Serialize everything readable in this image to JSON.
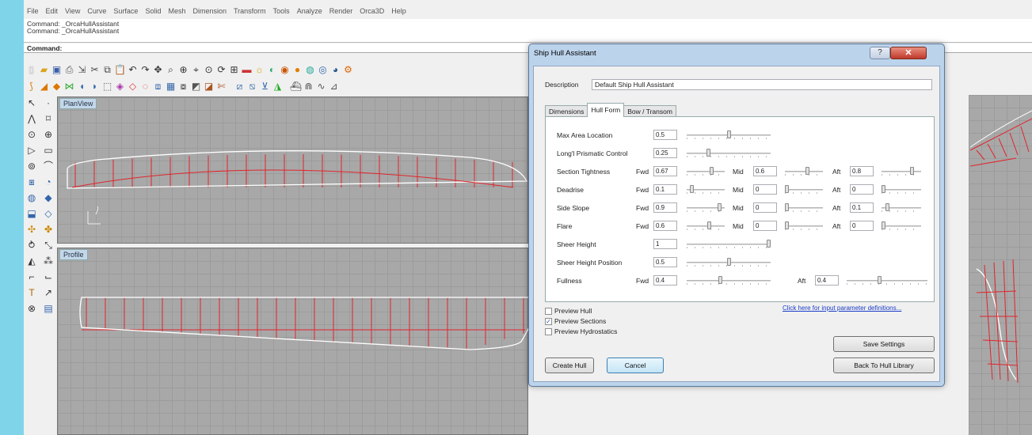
{
  "menu": [
    "File",
    "Edit",
    "View",
    "Curve",
    "Surface",
    "Solid",
    "Mesh",
    "Dimension",
    "Transform",
    "Tools",
    "Analyze",
    "Render",
    "Orca3D",
    "Help"
  ],
  "command_history": [
    "Command: _OrcaHullAssistant",
    "Command: _OrcaHullAssistant"
  ],
  "command_prompt": "Command:",
  "viewports": {
    "top": "PlanView",
    "bottom": "Profile"
  },
  "toolbar_icons": {
    "row1": [
      "new-icon",
      "open-icon",
      "save-icon",
      "print-icon",
      "import-icon",
      "cut-icon",
      "copy-icon",
      "paste-icon",
      "undo-icon",
      "redo-icon",
      "pan-icon",
      "zoom-icon",
      "zoom-window-icon",
      "zoom-extents-icon",
      "zoom-selected-icon",
      "rotate-icon",
      "grid-icon",
      "color-icon",
      "light-icon",
      "shade-icon",
      "render-icon",
      "material-icon",
      "layers-icon",
      "properties-icon",
      "sphere-icon",
      "options-icon"
    ],
    "row2": [
      "curve-icon",
      "surface-icon",
      "solid-icon",
      "mesh-icon",
      "fillet-icon",
      "blend-icon",
      "extrude-icon",
      "loft-icon",
      "sweep-icon",
      "revolve-icon",
      "network-icon",
      "patch-icon",
      "offset-icon",
      "cap-icon",
      "split-icon",
      "trim-icon",
      "join-icon",
      "explode-icon",
      "hull-icon",
      "hydrostatics-icon",
      "stability-icon",
      "sections-icon",
      "curvature-icon",
      "plane-icon"
    ]
  },
  "left_tools": [
    "select-icon",
    "point-icon",
    "polyline-icon",
    "rectangle-icon",
    "circle-icon",
    "arc-icon",
    "curve-tool-icon",
    "ellipse-icon",
    "polygon-icon",
    "fillet-tool-icon",
    "box-icon",
    "sphere-tool-icon",
    "cylinder-icon",
    "cone-icon",
    "extrude-tool-icon",
    "revolve-tool-icon",
    "move-icon",
    "copy-tool-icon",
    "rotate-tool-icon",
    "scale-icon",
    "mirror-icon",
    "array-icon",
    "trim-tool-icon",
    "split-tool-icon",
    "text-icon",
    "dimension-tool-icon",
    "analyze-icon",
    "render-tool-icon"
  ],
  "dialog": {
    "title": "Ship Hull Assistant",
    "help_label": "?",
    "close_label": "✕",
    "description_label": "Description",
    "description_value": "Default Ship Hull Assistant",
    "tabs": [
      "Dimensions",
      "Hull Form",
      "Bow / Transom"
    ],
    "active_tab": "Hull Form",
    "labels": {
      "fwd": "Fwd",
      "mid": "Mid",
      "aft": "Aft"
    },
    "params": {
      "max_area_location": {
        "label": "Max Area Location",
        "value": "0.5"
      },
      "longl_prismatic": {
        "label": "Long'l Prismatic Control",
        "value": "0.25"
      },
      "section_tightness": {
        "label": "Section Tightness",
        "fwd": "0.67",
        "mid": "0.6",
        "aft": "0.8"
      },
      "deadrise": {
        "label": "Deadrise",
        "fwd": "0.1",
        "mid": "0",
        "aft": "0"
      },
      "side_slope": {
        "label": "Side Slope",
        "fwd": "0.9",
        "mid": "0",
        "aft": "0.1"
      },
      "flare": {
        "label": "Flare",
        "fwd": "0.6",
        "mid": "0",
        "aft": "0"
      },
      "sheer_height": {
        "label": "Sheer Height",
        "value": "1"
      },
      "sheer_height_position": {
        "label": "Sheer Height Position",
        "value": "0.5"
      },
      "fullness": {
        "label": "Fullness",
        "fwd": "0.4",
        "aft": "0.4"
      }
    },
    "slider_levels": {
      "max_area_location": 0.5,
      "longl_prismatic": 0.25,
      "section_tightness_fwd": 0.67,
      "section_tightness_mid": 0.6,
      "section_tightness_aft": 0.8,
      "deadrise_fwd": 0.1,
      "deadrise_mid": 0.0,
      "deadrise_aft": 0.0,
      "side_slope_fwd": 0.9,
      "side_slope_mid": 0.0,
      "side_slope_aft": 0.1,
      "flare_fwd": 0.6,
      "flare_mid": 0.0,
      "flare_aft": 0.0,
      "sheer_height": 1.0,
      "sheer_height_position": 0.5,
      "fullness_fwd": 0.4,
      "fullness_aft": 0.4
    },
    "checkboxes": [
      {
        "label": "Preview Hull",
        "checked": false
      },
      {
        "label": "Preview Sections",
        "checked": true
      },
      {
        "label": "Preview Hydrostatics",
        "checked": false
      }
    ],
    "link_text": "Click here for input parameter definitions...",
    "buttons": {
      "save_settings": "Save Settings",
      "back_to_library": "Back To Hull Library",
      "create_hull": "Create Hull",
      "cancel": "Cancel"
    }
  },
  "colors": {
    "section_lines": "#e0252b",
    "hull_outline": "#ffffff",
    "viewport_bg": "#a8a8a8",
    "dialog_frame": "#bcd3ec"
  }
}
